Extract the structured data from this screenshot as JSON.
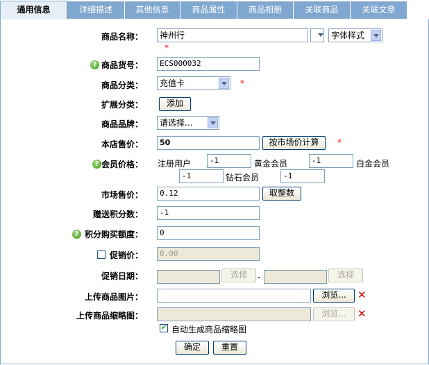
{
  "tabs": [
    "通用信息",
    "详细描述",
    "其他信息",
    "商品属性",
    "商品相册",
    "关联商品",
    "关联文章"
  ],
  "form": {
    "name": {
      "label": "商品名称：",
      "value": "神州行",
      "style_label": "字体样式",
      "required": "*"
    },
    "sn": {
      "label": "商品货号：",
      "value": "ECS000032"
    },
    "category": {
      "label": "商品分类：",
      "value": "充值卡",
      "required": "*"
    },
    "ext_category": {
      "label": "扩展分类：",
      "add": "添加"
    },
    "brand": {
      "label": "商品品牌：",
      "value": "请选择..."
    },
    "shop_price": {
      "label": "本店售价：",
      "value": "50",
      "button": "按市场价计算",
      "required": "*"
    },
    "member_price": {
      "label": "会员价格：",
      "ranks": [
        {
          "name": "注册用户",
          "value": "-1"
        },
        {
          "name": "黄金会员",
          "value": "-1"
        },
        {
          "name": "白金会员",
          "value": "-1"
        },
        {
          "name": "钻石会员",
          "value": "-1"
        }
      ]
    },
    "market_price": {
      "label": "市场售价：",
      "value": "0.12",
      "button": "取整数"
    },
    "give_integral": {
      "label": "赠送积分数：",
      "value": "-1"
    },
    "integral": {
      "label": "积分购买额度：",
      "value": "0"
    },
    "promote": {
      "label": "促销价：",
      "value": "0.00"
    },
    "promote_date": {
      "label": "促销日期：",
      "select1": "选择",
      "sep": "-",
      "select2": "选择"
    },
    "goods_img": {
      "label": "上传商品图片：",
      "browse": "浏览..."
    },
    "goods_thumb": {
      "label": "上传商品缩略图：",
      "browse": "浏览..."
    },
    "auto_thumb": {
      "label": "自动生成商品缩略图"
    },
    "submit": "确定",
    "reset": "重置"
  },
  "colors": {
    "tab_bg": "#7fa7cf",
    "required": "#ff0000",
    "delete": "#dd0000"
  },
  "icons": {
    "help": "help-icon",
    "delete": "delete-x-icon"
  }
}
